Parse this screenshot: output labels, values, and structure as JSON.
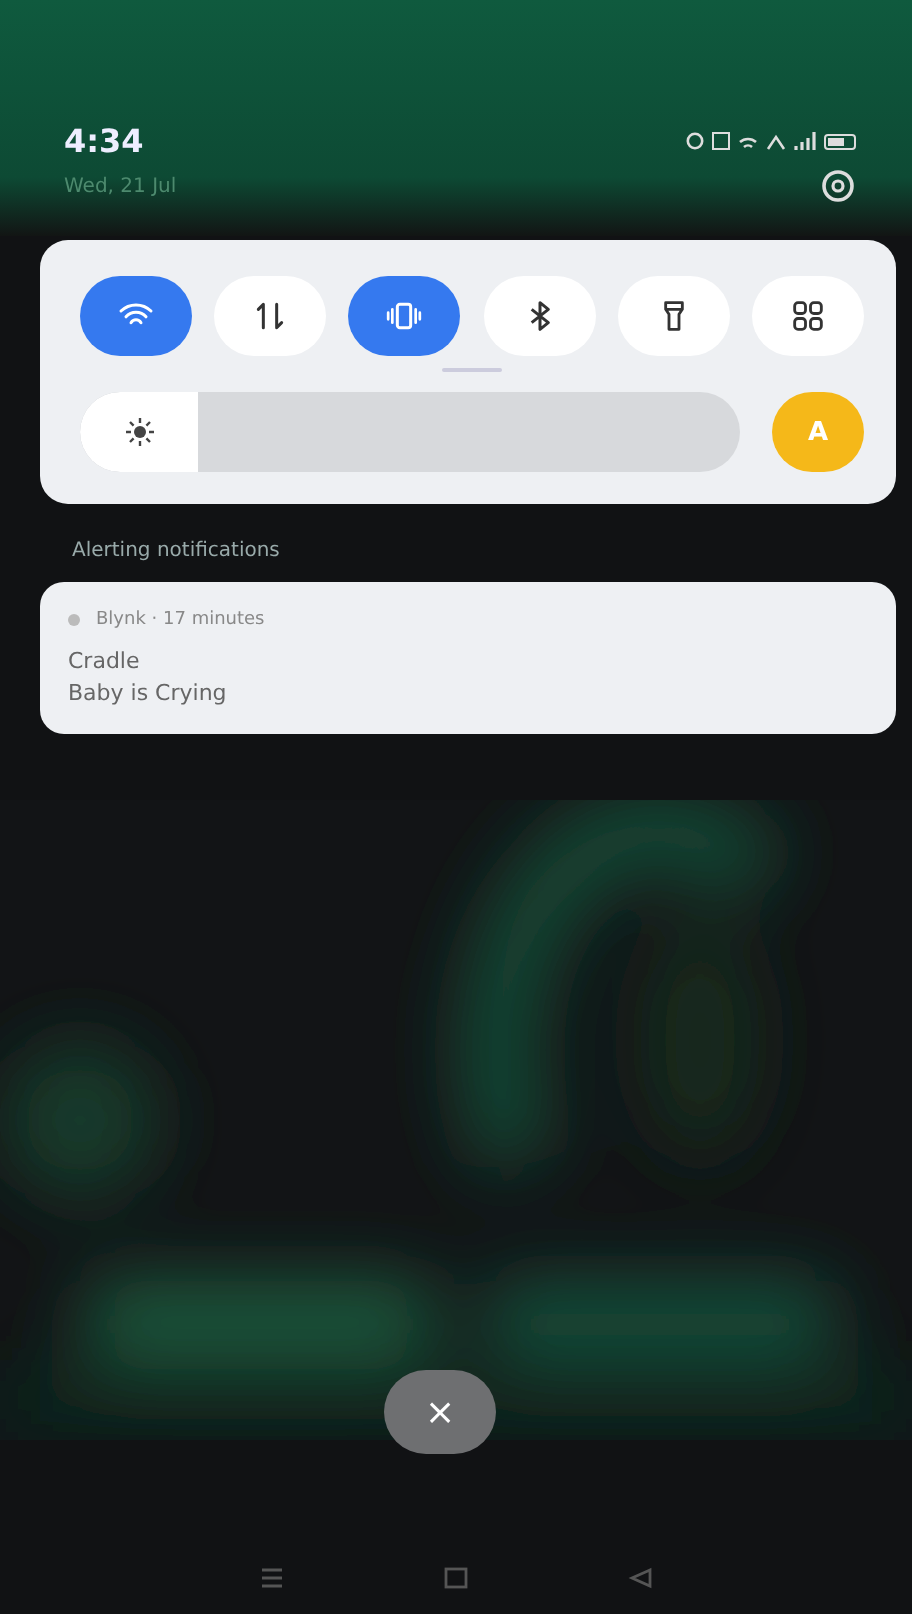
{
  "status_bar": {
    "time": "4:34"
  },
  "header": {
    "date": "Wed, 21 Jul"
  },
  "quick_settings": {
    "tiles": [
      {
        "kind": "wifi",
        "on": true
      },
      {
        "kind": "data",
        "on": false
      },
      {
        "kind": "vibrate",
        "on": true
      },
      {
        "kind": "bluetooth",
        "on": false
      },
      {
        "kind": "flashlight",
        "on": false
      },
      {
        "kind": "grid",
        "on": false
      }
    ],
    "brightness": {
      "level": 0.18,
      "auto_label": "A",
      "auto_on": true
    }
  },
  "section_label": "Alerting notifications",
  "notifications": [
    {
      "app": "Blynk · 17 minutes",
      "title": "Cradle",
      "text": "Baby is Crying"
    }
  ],
  "clear_button": {
    "label": "×"
  }
}
